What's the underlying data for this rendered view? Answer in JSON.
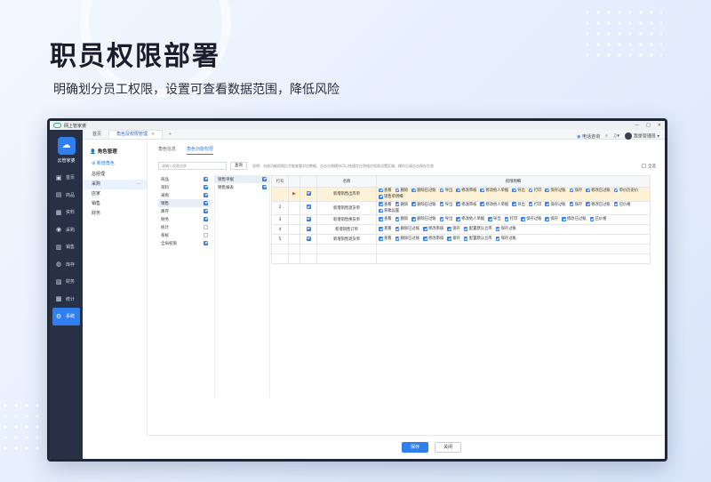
{
  "hero": {
    "title": "职员权限部署",
    "subtitle": "明确划分员工权限，设置可查看数据范围，降低风险"
  },
  "window": {
    "app_name": "网上管家婆",
    "controls": [
      "—",
      "□",
      "✕"
    ]
  },
  "tabs": [
    {
      "label": "首页"
    },
    {
      "label": "角色及权限管理",
      "active": true
    },
    {
      "label": "+"
    }
  ],
  "topbar": {
    "service_label": "电话咨询",
    "user_label": "我是管理员"
  },
  "brand": {
    "name": "云管家婆"
  },
  "sidebar": {
    "items": [
      {
        "icon": "sales-icon",
        "glyph": "▣",
        "label": "首页"
      },
      {
        "icon": "goods-icon",
        "glyph": "▤",
        "label": "商品"
      },
      {
        "icon": "archive-icon",
        "glyph": "▦",
        "label": "资料"
      },
      {
        "icon": "purchase-icon",
        "glyph": "◉",
        "label": "采购"
      },
      {
        "icon": "sale-icon",
        "glyph": "▥",
        "label": "销售"
      },
      {
        "icon": "stock-icon",
        "glyph": "◍",
        "label": "库存"
      },
      {
        "icon": "finance-icon",
        "glyph": "▧",
        "label": "财务"
      },
      {
        "icon": "stats-icon",
        "glyph": "▩",
        "label": "统计"
      },
      {
        "icon": "system-icon",
        "glyph": "⚙",
        "label": "系统",
        "active": true
      }
    ]
  },
  "role_panel": {
    "title": "角色管理",
    "add_label": "新增角色",
    "roles": [
      {
        "label": "总经理"
      },
      {
        "label": "采购",
        "selected": true
      },
      {
        "label": "店家"
      },
      {
        "label": "销售"
      },
      {
        "label": "财务"
      }
    ]
  },
  "content": {
    "subtabs": [
      "角色信息",
      "角色功能权限"
    ],
    "search_placeholder": "请输入权限名称",
    "query_label": "查询",
    "hint": "说明：勾选功能权限后才能查看对应数据，点击左侧模块可以快速定位到相应权限设置区域，操作后请点击保存生效",
    "select_all_label": "全选",
    "modules": [
      {
        "label": "商品",
        "checked": true
      },
      {
        "label": "资料",
        "checked": true
      },
      {
        "label": "采购",
        "checked": true
      },
      {
        "label": "销售",
        "checked": true,
        "selected": true
      },
      {
        "label": "库存",
        "checked": true
      },
      {
        "label": "财务",
        "checked": true
      },
      {
        "label": "统计",
        "checked": false
      },
      {
        "label": "系统",
        "checked": false
      },
      {
        "label": "全局权限",
        "checked": true
      }
    ],
    "submodules": [
      {
        "label": "销售单据",
        "checked": true,
        "selected": true
      },
      {
        "label": "销售报表",
        "checked": true
      }
    ],
    "table": {
      "headers": [
        "行号",
        "",
        "名称",
        "权限明细"
      ],
      "rows": [
        {
          "no": "",
          "name": "新增销售出库单",
          "perms": [
            "查看",
            "删除",
            "删除已过账",
            "导出",
            "修改审核",
            "修改他人单据",
            "导出",
            "打印",
            "保存过账",
            "保存",
            "修改已过账",
            "单价历史价",
            "销售单明细"
          ],
          "highlight": true
        },
        {
          "no": "2",
          "name": "新增销售退货单",
          "perms": [
            "查看",
            "删除",
            "删除已过账",
            "导出",
            "修改审核",
            "修改他人单据",
            "导出",
            "打印",
            "保存过账",
            "保存",
            "修改已过账",
            "已价格",
            "草稿设置"
          ]
        },
        {
          "no": "3",
          "name": "新增销售换货单",
          "perms": [
            "查看",
            "删除",
            "删除已过账",
            "导出",
            "修改他人单据",
            "导出",
            "打印",
            "保存过账",
            "保存",
            "修改已过账",
            "已价格"
          ]
        },
        {
          "no": "4",
          "name": "新增销售订单",
          "perms": [
            "查看",
            "删除已过账",
            "修改审核",
            "保存",
            "配置默认仓库",
            "保存过账"
          ]
        },
        {
          "no": "5",
          "name": "新增销售退货单",
          "perms": [
            "查看",
            "删除已过账",
            "修改审核",
            "保存",
            "配置默认仓库",
            "保存过账"
          ]
        }
      ]
    }
  },
  "footer": {
    "save_label": "保存",
    "close_label": "关闭"
  },
  "colors": {
    "accent": "#2f7ff0",
    "sidebar_bg": "#273045",
    "highlight_row": "#fdf2d6"
  }
}
